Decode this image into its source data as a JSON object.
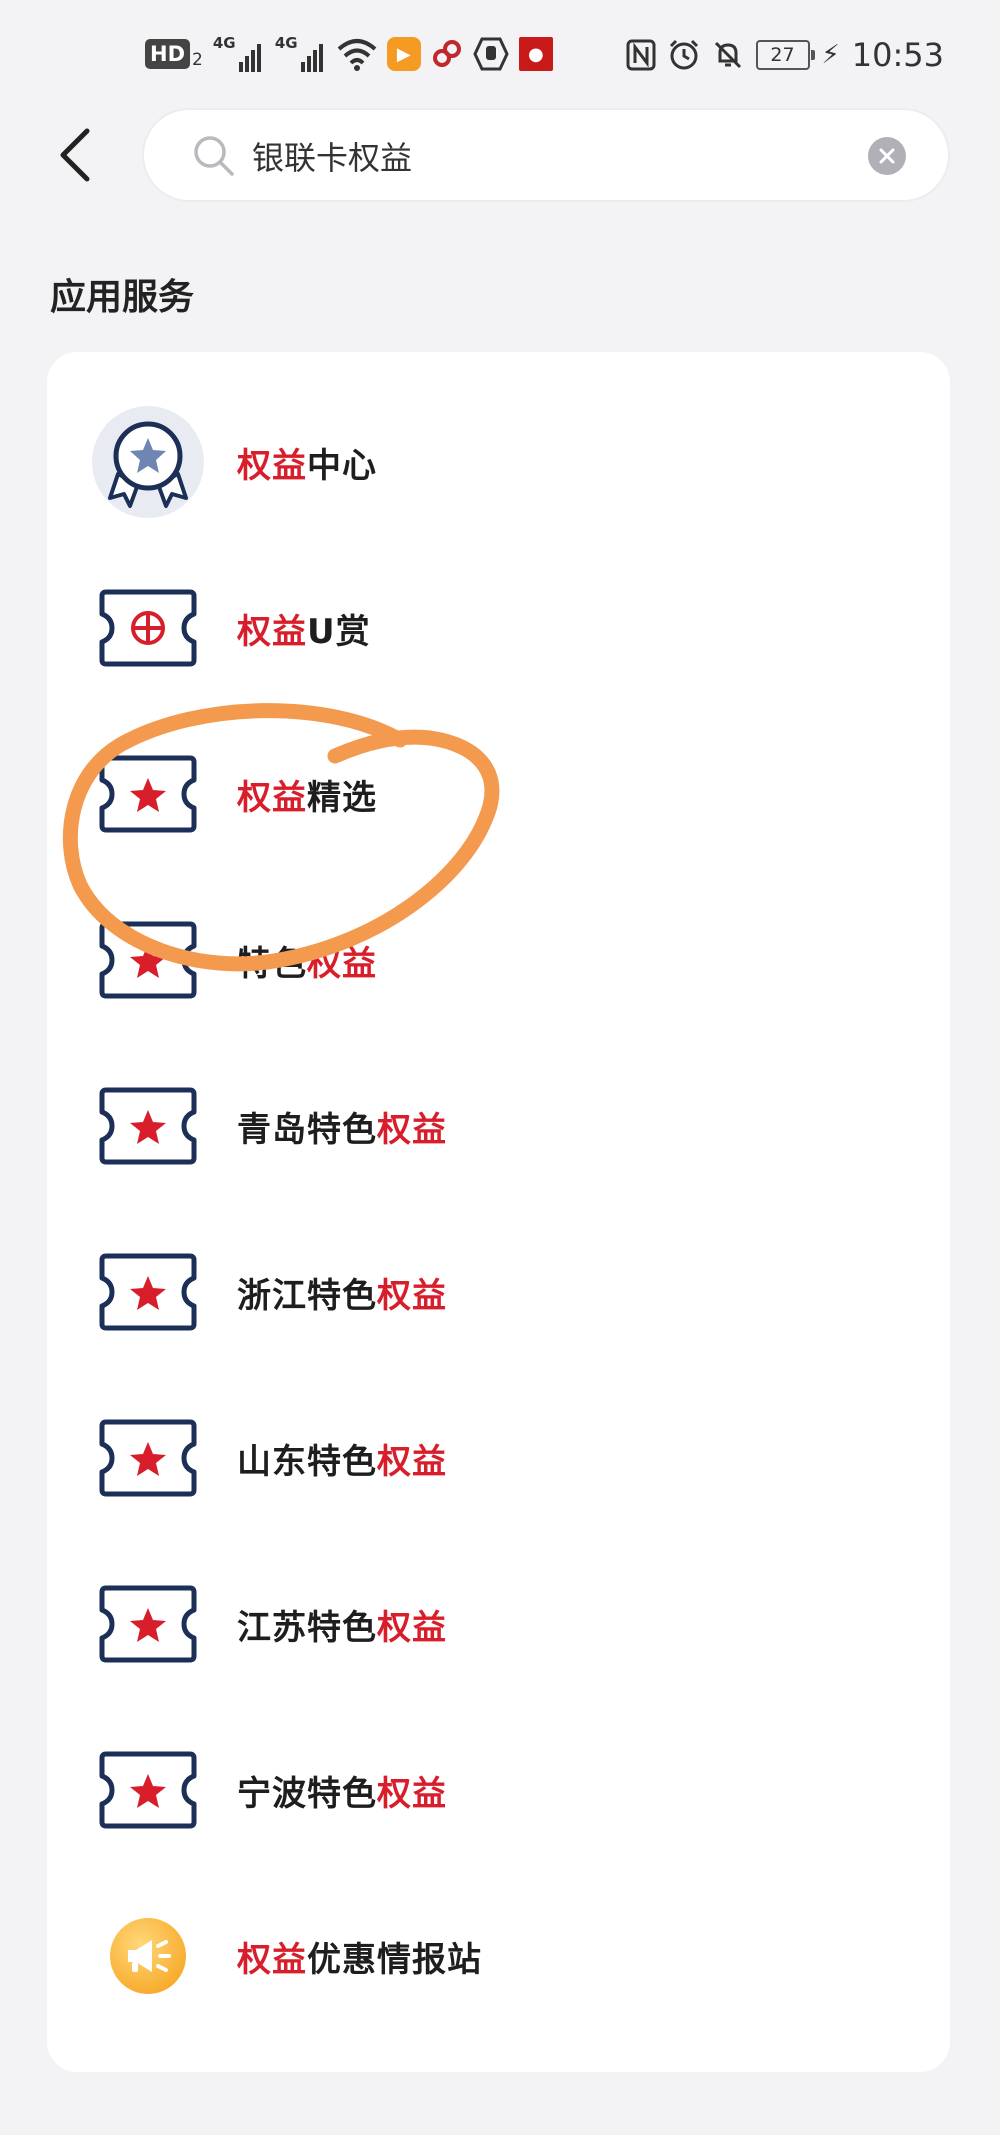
{
  "status_bar": {
    "hd_label": "HD",
    "hd_sub": "2",
    "signal1_label": "4G",
    "signal2_label": "4G",
    "battery": "27",
    "time": "10:53"
  },
  "search": {
    "query": "银联卡权益"
  },
  "section": {
    "title": "应用服务"
  },
  "colors": {
    "highlight": "#d81e2b",
    "icon_navy": "#1b2f57",
    "annotation": "#f39a4e"
  },
  "results": [
    {
      "icon": "medal-star-icon",
      "parts": [
        {
          "text": "权益",
          "hl": true
        },
        {
          "text": "中心",
          "hl": false
        }
      ]
    },
    {
      "icon": "ticket-globe-icon",
      "parts": [
        {
          "text": "权益",
          "hl": true
        },
        {
          "text": "U赏",
          "hl": false
        }
      ]
    },
    {
      "icon": "ticket-star-icon",
      "parts": [
        {
          "text": "权益",
          "hl": true
        },
        {
          "text": "精选",
          "hl": false
        }
      ]
    },
    {
      "icon": "ticket-star-icon",
      "parts": [
        {
          "text": "特色",
          "hl": false
        },
        {
          "text": "权益",
          "hl": true
        }
      ]
    },
    {
      "icon": "ticket-star-icon",
      "parts": [
        {
          "text": "青岛特色",
          "hl": false
        },
        {
          "text": "权益",
          "hl": true
        }
      ]
    },
    {
      "icon": "ticket-star-icon",
      "parts": [
        {
          "text": "浙江特色",
          "hl": false
        },
        {
          "text": "权益",
          "hl": true
        }
      ]
    },
    {
      "icon": "ticket-star-icon",
      "parts": [
        {
          "text": "山东特色",
          "hl": false
        },
        {
          "text": "权益",
          "hl": true
        }
      ]
    },
    {
      "icon": "ticket-star-icon",
      "parts": [
        {
          "text": "江苏特色",
          "hl": false
        },
        {
          "text": "权益",
          "hl": true
        }
      ]
    },
    {
      "icon": "ticket-star-icon",
      "parts": [
        {
          "text": "宁波特色",
          "hl": false
        },
        {
          "text": "权益",
          "hl": true
        }
      ]
    },
    {
      "icon": "megaphone-icon",
      "parts": [
        {
          "text": "权益",
          "hl": true
        },
        {
          "text": "优惠情报站",
          "hl": false
        }
      ]
    }
  ]
}
